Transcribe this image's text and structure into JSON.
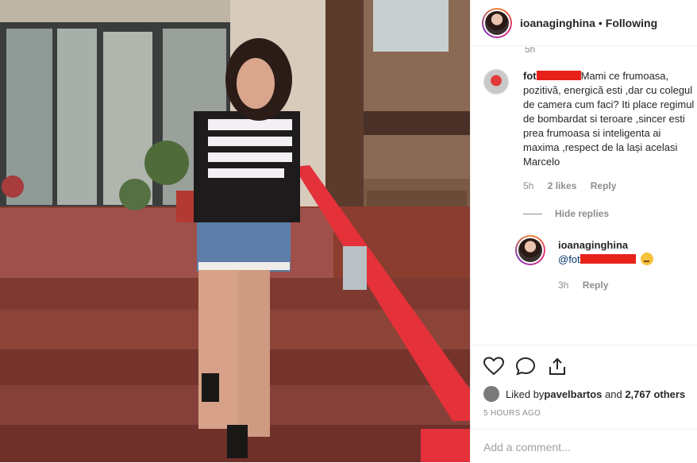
{
  "post": {
    "username": "ioanaginghina",
    "separator": "•",
    "follow_status": "Following"
  },
  "comments": {
    "stub_time": "5h",
    "item": {
      "username_visible": "fot",
      "text": "Mami ce frumoasa, pozitivă, energică esti ,dar cu colegul de camera cum faci? Iti place regimul de bombardat si teroare ,sincer esti prea frumoasa si inteligenta ai maxima ,respect de la lași acelasi Marcelo",
      "time": "5h",
      "likes": "2 likes",
      "reply_label": "Reply"
    },
    "hide_replies": "Hide replies",
    "reply": {
      "username": "ioanaginghina",
      "mention": "@fot",
      "time": "3h",
      "reply_label": "Reply"
    }
  },
  "actions": {
    "icons": [
      "heart-icon",
      "comment-icon",
      "share-icon"
    ],
    "liked_by_prefix": "Liked by ",
    "liked_by_user": "pavelbartos",
    "liked_by_mid": " and ",
    "liked_by_count": "2,767 others",
    "timestamp": "5 HOURS AGO",
    "add_comment_placeholder": "Add a comment..."
  },
  "colors": {
    "redaction": "#e8221b",
    "meta_text": "#8e8e8e",
    "mention": "#003569"
  }
}
